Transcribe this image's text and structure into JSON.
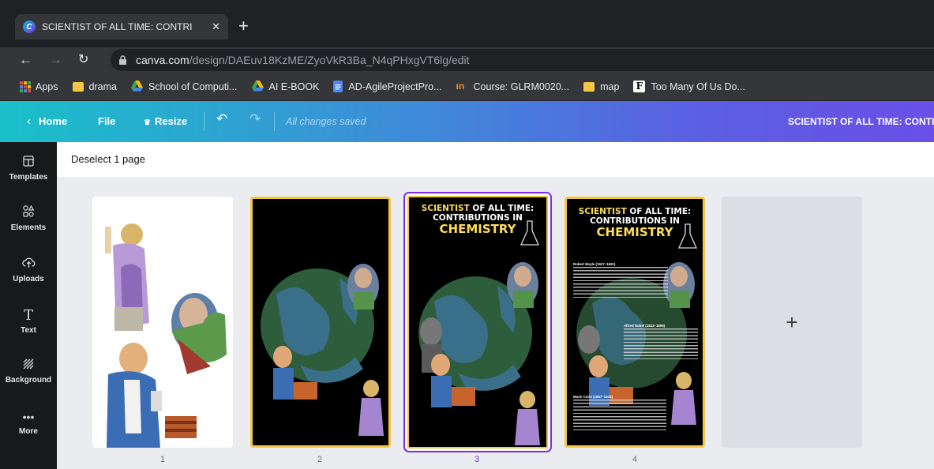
{
  "browser": {
    "tab_title": "SCIENTIST OF ALL TIME: CONTRI",
    "tab_icon": "canva-favicon",
    "url_domain": "canva.com",
    "url_path": "/design/DAEuv18KzME/ZyoVkR3Ba_N4qPHxgVT6lg/edit",
    "bookmarks": [
      "Apps",
      "drama",
      "School of Computi...",
      "AI E-BOOK",
      "AD-AgileProjectPro...",
      "Course: GLRM0020...",
      "map",
      "Too Many Of Us Do..."
    ]
  },
  "editor": {
    "home": "Home",
    "file": "File",
    "resize": "Resize",
    "status": "All changes saved",
    "design_title": "SCIENTIST OF ALL TIME: CONTR",
    "deselect": "Deselect 1 page"
  },
  "sidebar": {
    "items": [
      {
        "label": "Templates",
        "icon": "templates-icon"
      },
      {
        "label": "Elements",
        "icon": "elements-icon"
      },
      {
        "label": "Uploads",
        "icon": "uploads-icon"
      },
      {
        "label": "Text",
        "icon": "text-icon"
      },
      {
        "label": "Background",
        "icon": "background-icon"
      },
      {
        "label": "More",
        "icon": "more-icon"
      }
    ]
  },
  "pages": [
    {
      "number": "1"
    },
    {
      "number": "2"
    },
    {
      "number": "3",
      "selected": true
    },
    {
      "number": "4"
    }
  ],
  "poster": {
    "line1a": "SCIENTIST",
    "line1b": " OF ALL TIME:",
    "line2": "CONTRIBUTIONS IN",
    "line3": "CHEMISTRY",
    "boyle_title": "Robert Boyle (1627–1691)",
    "nobel_title": "Alfred Nobel (1833–1896)",
    "curie_title": "Marie Curie (1867–1934)"
  },
  "colors": {
    "accent": "#7d2ae8",
    "page_border": "#f4c542",
    "poster_yellow": "#ffde59"
  },
  "add_page_symbol": "+"
}
